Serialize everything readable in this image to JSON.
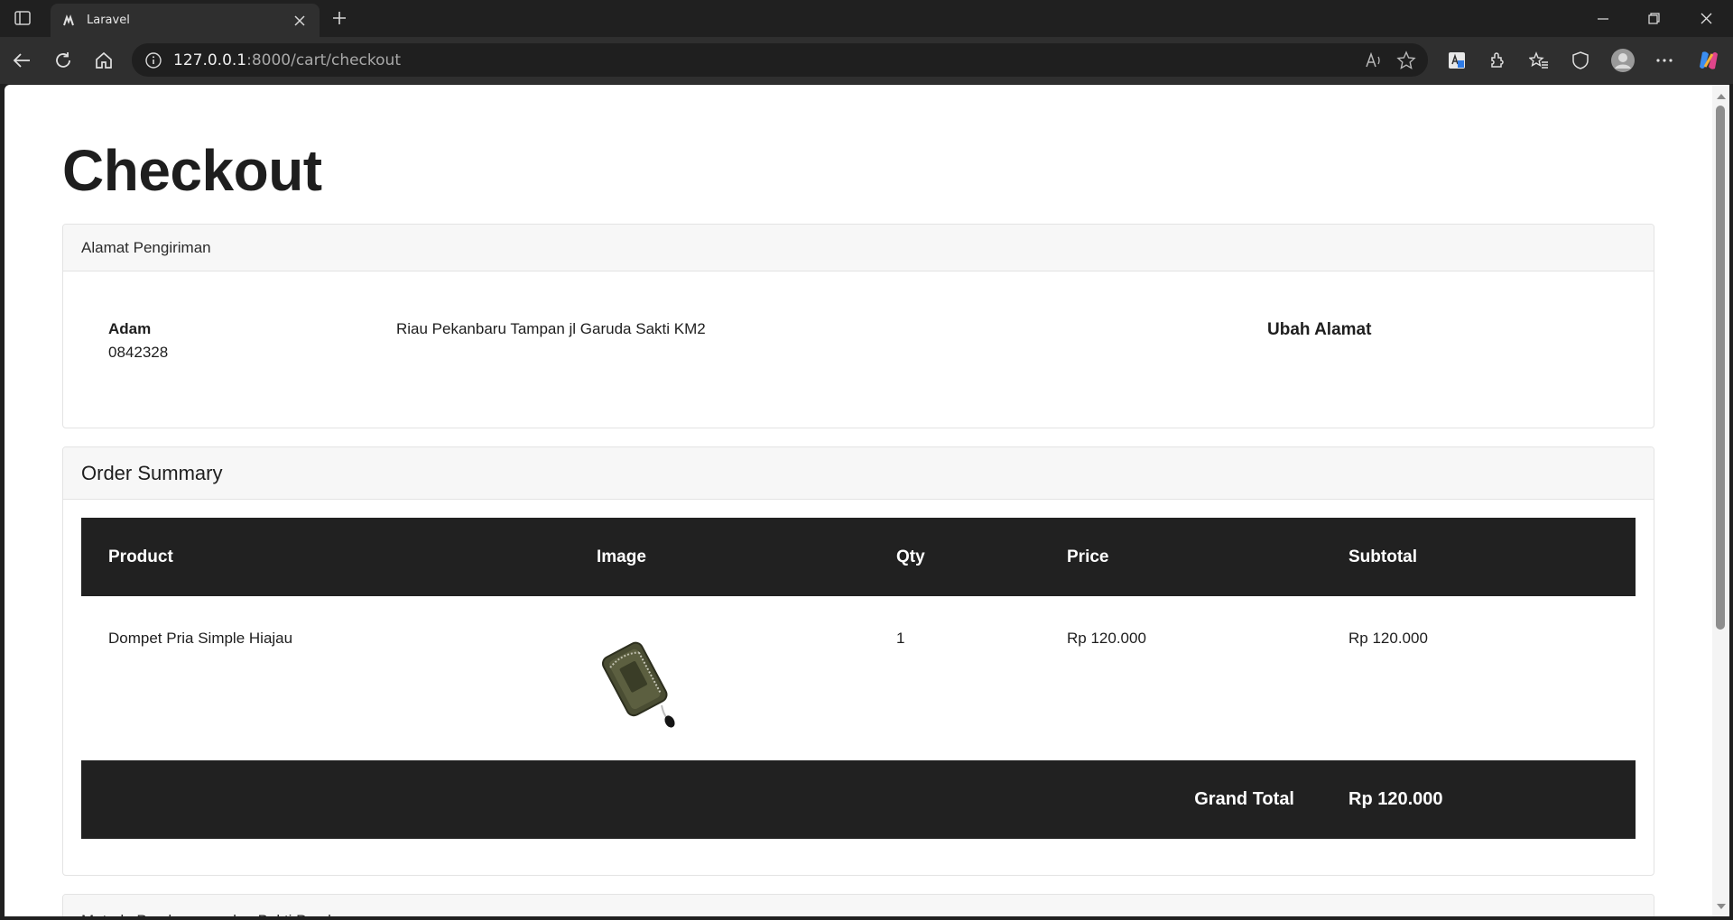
{
  "browser": {
    "tab_title": "Laravel",
    "url_host": "127.0.0.1",
    "url_path": ":8000/cart/checkout"
  },
  "page": {
    "title": "Checkout"
  },
  "shipping": {
    "header": "Alamat Pengiriman",
    "name": "Adam",
    "phone": "0842328",
    "address": "Riau Pekanbaru Tampan jl Garuda Sakti KM2",
    "change_label": "Ubah Alamat"
  },
  "order": {
    "header": "Order Summary",
    "columns": [
      "Product",
      "Image",
      "Qty",
      "Price",
      "Subtotal"
    ],
    "rows": [
      {
        "product": "Dompet Pria Simple Hiajau",
        "image": "wallet-image",
        "qty": "1",
        "price": "Rp 120.000",
        "subtotal": "Rp 120.000"
      }
    ],
    "grand_total_label": "Grand Total",
    "grand_total_value": "Rp 120.000"
  },
  "payment": {
    "header": "Metode Pembayaran dan Bukti Pembayaran"
  },
  "colors": {
    "table_dark": "#212121",
    "chrome_bg": "#202020",
    "toolbar_bg": "#2f2f2f"
  }
}
